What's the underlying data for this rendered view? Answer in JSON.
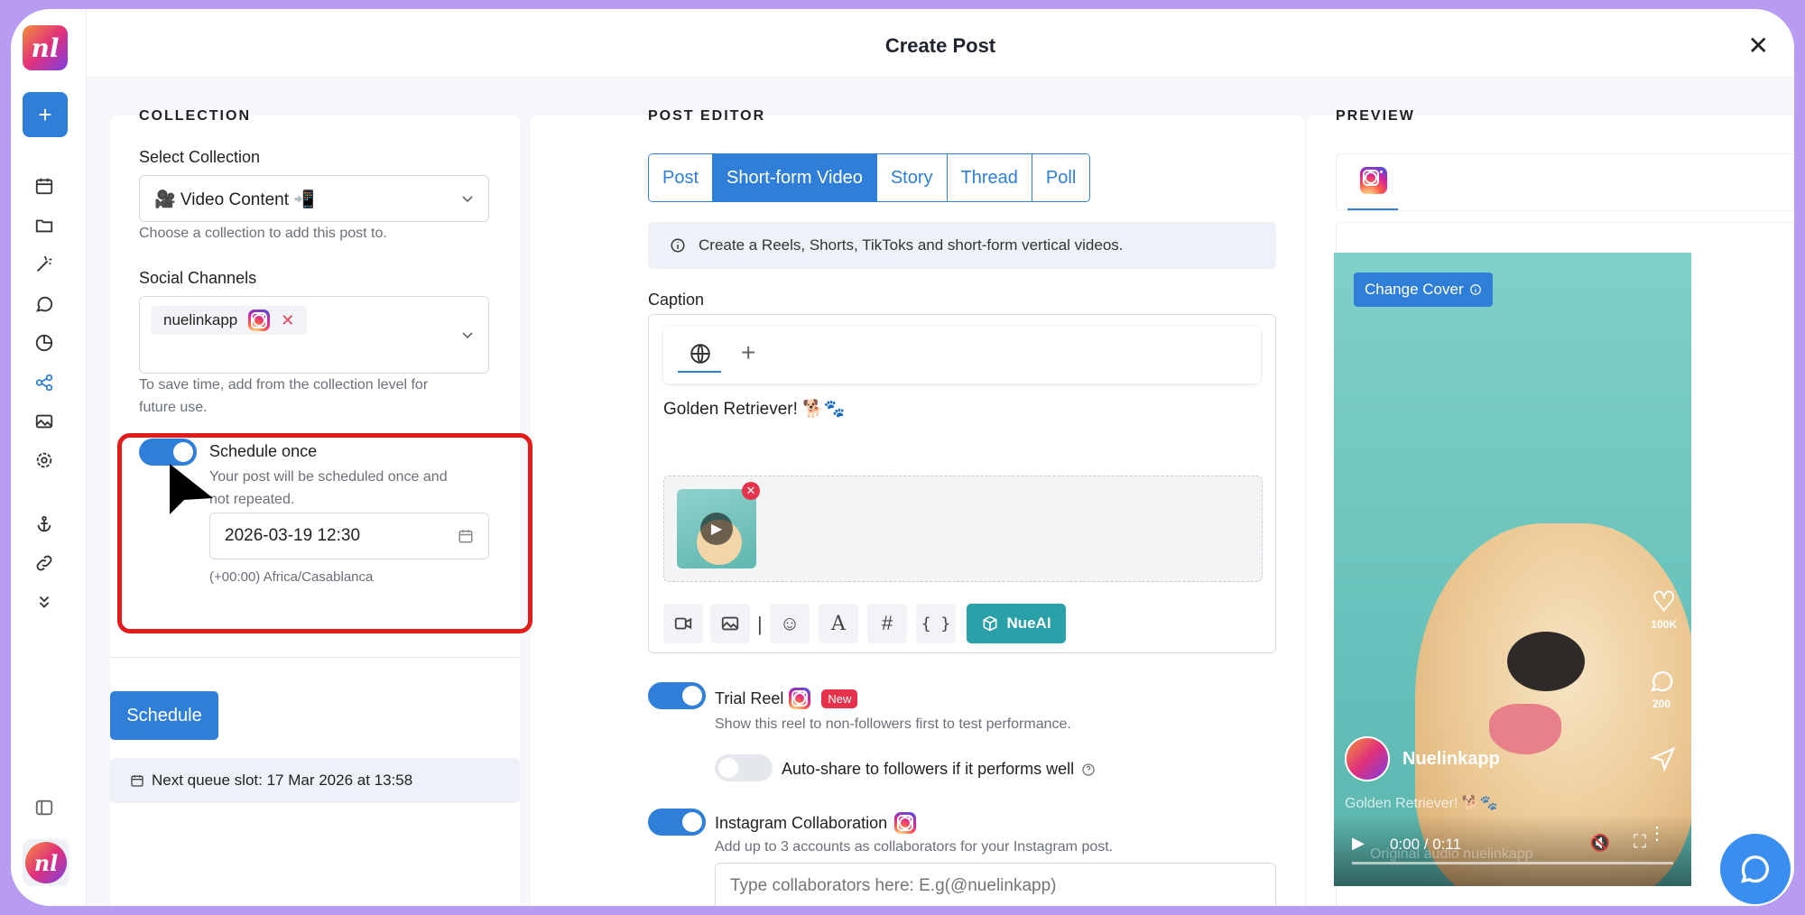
{
  "app": {
    "logo_text": "nl",
    "avatar_text": "nl"
  },
  "header": {
    "title": "Create Post",
    "close_label": "✕"
  },
  "sidebar": {
    "add_label": "+",
    "icons": [
      "calendar-icon",
      "folder-icon",
      "magic-wand-icon",
      "chat-icon",
      "pie-chart-icon",
      "share-icon",
      "gallery-icon",
      "settings-icon",
      "anchor-icon",
      "link-icon",
      "chevrons-down-icon",
      "panel-toggle-icon"
    ]
  },
  "collection": {
    "heading": "COLLECTION",
    "select_label": "Select Collection",
    "select_value": "🎥 Video Content 📲",
    "select_hint": "Choose a collection to add this post to.",
    "channels_label": "Social Channels",
    "channel_chip": "nuelinkapp",
    "channels_hint_1": "To save time, add from the collection level for",
    "channels_hint_2": "future use.",
    "schedule_toggle_label": "Schedule once",
    "schedule_hint_1": "Your post will be scheduled once and",
    "schedule_hint_2": "not repeated.",
    "datetime_value": "2026-03-19 12:30",
    "timezone": "(+00:00) Africa/Casablanca",
    "schedule_button": "Schedule",
    "next_slot": "Next queue slot: 17 Mar 2026 at 13:58"
  },
  "editor": {
    "heading": "POST EDITOR",
    "tabs": [
      "Post",
      "Short-form Video",
      "Story",
      "Thread",
      "Poll"
    ],
    "active_tab": "Short-form Video",
    "info_text": "Create a Reels, Shorts, TikToks and short-form vertical videos.",
    "caption_label": "Caption",
    "caption_text": "Golden Retriever! 🐕🐾",
    "toolbar_separator": "|",
    "nueai_label": "NueAI",
    "trial_reel_label": "Trial Reel",
    "new_badge": "New",
    "trial_reel_hint": "Show this reel to non-followers first to test performance.",
    "autoshare_label": "Auto-share to followers if it performs well",
    "collab_label": "Instagram Collaboration",
    "collab_hint": "Add up to 3 accounts as collaborators for your Instagram post.",
    "collab_placeholder": "Type collaborators here: E.g(@nuelinkapp)"
  },
  "preview": {
    "heading": "PREVIEW",
    "change_cover": "Change Cover",
    "likes": "100K",
    "comments": "200",
    "username": "Nuelinkapp",
    "caption": "Golden Retriever! 🐕🐾",
    "audio": "Original audio nuelinkapp",
    "time": "0:00 / 0:11"
  },
  "colors": {
    "accent": "#2f7ed8",
    "highlight_box": "#e21b1b",
    "nueai": "#2aa0a8",
    "frame": "#b79cf2"
  }
}
